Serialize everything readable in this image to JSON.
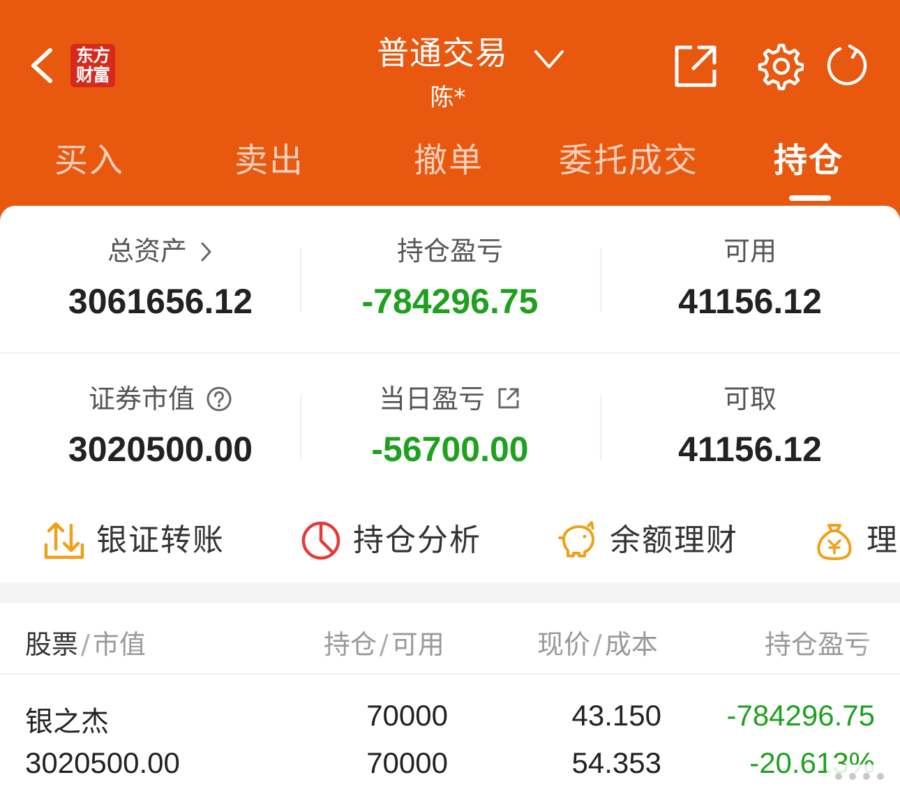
{
  "header": {
    "logo_line1": "东方",
    "logo_line2": "财富",
    "title": "普通交易",
    "subtitle": "陈*",
    "bg_color": "#e8580f"
  },
  "tabs": [
    {
      "label": "买入"
    },
    {
      "label": "卖出"
    },
    {
      "label": "撤单"
    },
    {
      "label": "委托成交"
    },
    {
      "label": "持仓",
      "active": true
    }
  ],
  "summary": {
    "total_assets_label": "总资产",
    "total_assets_value": "3061656.12",
    "holding_pnl_label": "持仓盈亏",
    "holding_pnl_value": "-784296.75",
    "available_label": "可用",
    "available_value": "41156.12",
    "market_value_label": "证券市值",
    "market_value_value": "3020500.00",
    "daily_pnl_label": "当日盈亏",
    "daily_pnl_value": "-56700.00",
    "withdrawable_label": "可取",
    "withdrawable_value": "41156.12",
    "loss_color": "#1ea11e"
  },
  "shortcuts": [
    {
      "label": "银证转账",
      "icon": "transfer-icon"
    },
    {
      "label": "持仓分析",
      "icon": "pie-chart-icon"
    },
    {
      "label": "余额理财",
      "icon": "piggy-bank-icon"
    },
    {
      "label": "理财",
      "icon": "money-bag-icon"
    }
  ],
  "table": {
    "col1_main": "股票",
    "col1_sub": "市值",
    "col2_main": "持仓",
    "col2_sub": "可用",
    "col3_main": "现价",
    "col3_sub": "成本",
    "col4": "持仓盈亏",
    "rows": [
      {
        "name": "银之杰",
        "market_value": "3020500.00",
        "position": "70000",
        "available": "70000",
        "price": "43.150",
        "cost": "54.353",
        "pnl": "-784296.75",
        "pnl_pct": "-20.613%"
      }
    ]
  }
}
